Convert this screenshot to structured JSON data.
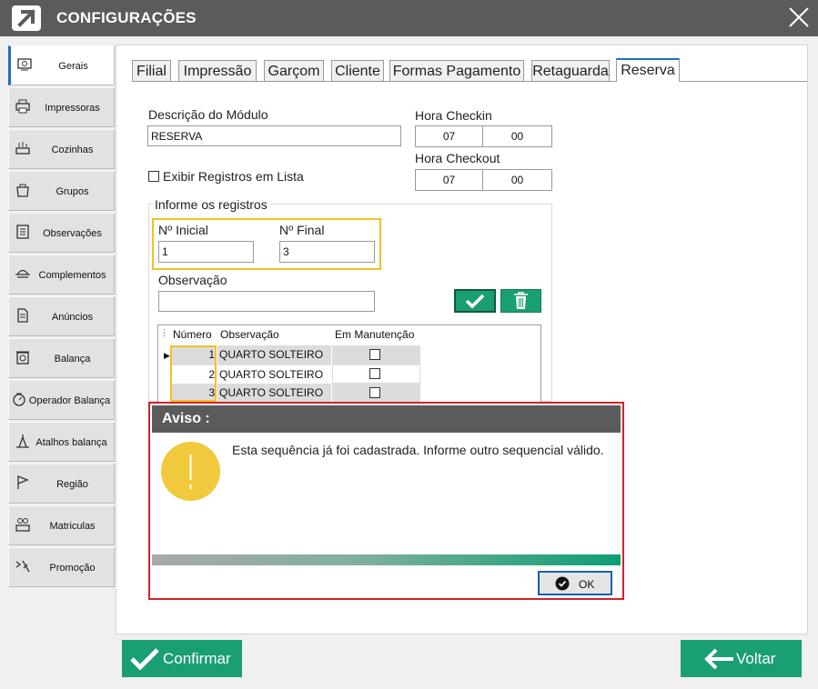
{
  "window": {
    "title": "CONFIGURAÇÕES"
  },
  "sidebar": {
    "items": [
      {
        "label": "Gerais",
        "icon": "settings-screen-icon",
        "active": true
      },
      {
        "label": "Impressoras",
        "icon": "printer-icon"
      },
      {
        "label": "Cozinhas",
        "icon": "kitchen-icon"
      },
      {
        "label": "Grupos",
        "icon": "groups-icon"
      },
      {
        "label": "Observações",
        "icon": "notes-icon"
      },
      {
        "label": "Complementos",
        "icon": "complements-icon"
      },
      {
        "label": "Anúncios",
        "icon": "document-icon"
      },
      {
        "label": "Balança",
        "icon": "scale-icon"
      },
      {
        "label": "Operador  Balança",
        "icon": "scale-operator-icon"
      },
      {
        "label": "Atalhos balança",
        "icon": "scale-shortcut-icon"
      },
      {
        "label": "Região",
        "icon": "flag-icon"
      },
      {
        "label": "Matriculas",
        "icon": "registration-icon"
      },
      {
        "label": "Promoção",
        "icon": "promotion-icon"
      }
    ]
  },
  "tabs": [
    {
      "label": "Filial"
    },
    {
      "label": "Impressão"
    },
    {
      "label": "Garçom"
    },
    {
      "label": "Cliente"
    },
    {
      "label": "Formas Pagamento"
    },
    {
      "label": "Retaguarda"
    },
    {
      "label": "Reserva",
      "active": true
    }
  ],
  "form": {
    "descricao_label": "Descrição do Módulo",
    "descricao_value": "RESERVA",
    "checkin_label": "Hora Checkin",
    "checkin_hour": "07",
    "checkin_min": "00",
    "checkout_label": "Hora Checkout",
    "checkout_hour": "07",
    "checkout_min": "00",
    "exibir_label": "Exibir Registros em Lista",
    "informe_label": "Informe os registros",
    "inicial_label": "Nº Inicial",
    "inicial_value": "1",
    "final_label": "Nº Final",
    "final_value": "3",
    "observacao_label": "Observação",
    "observacao_value": ""
  },
  "grid": {
    "columns": [
      "Número",
      "Observação",
      "Em Manutenção"
    ],
    "rows": [
      {
        "numero": "1",
        "observacao": "QUARTO SOLTEIRO",
        "manutencao": false
      },
      {
        "numero": "2",
        "observacao": "QUARTO SOLTEIRO",
        "manutencao": false
      },
      {
        "numero": "3",
        "observacao": "QUARTO SOLTEIRO",
        "manutencao": false
      }
    ]
  },
  "dialog": {
    "title": "Aviso :",
    "message": "Esta sequência já foi cadastrada. Informe outro sequencial válido.",
    "ok_label": "OK"
  },
  "footer": {
    "confirm_label": "Confirmar",
    "back_label": "Voltar"
  },
  "colors": {
    "accent_green": "#1a9e73",
    "title_bar": "#5b5b5b",
    "highlight_yellow": "#f1c126",
    "highlight_red": "#d2232a",
    "warning_yellow": "#f0c93c"
  }
}
